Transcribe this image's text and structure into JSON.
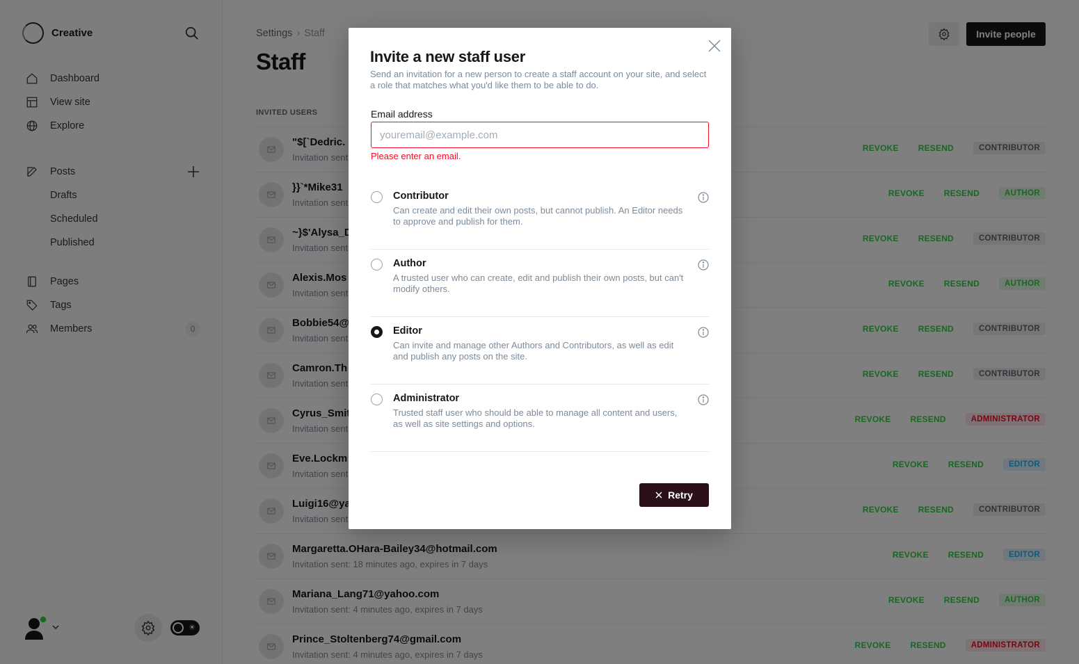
{
  "sidebar": {
    "brand": "Creative",
    "nav": [
      {
        "label": "Dashboard",
        "icon": "home-icon"
      },
      {
        "label": "View site",
        "icon": "layout-icon"
      },
      {
        "label": "Explore",
        "icon": "globe-icon"
      }
    ],
    "posts": {
      "label": "Posts",
      "icon": "edit-icon"
    },
    "post_sub": [
      "Drafts",
      "Scheduled",
      "Published"
    ],
    "nav2": [
      {
        "label": "Pages",
        "icon": "page-icon"
      },
      {
        "label": "Tags",
        "icon": "tag-icon"
      },
      {
        "label": "Members",
        "icon": "members-icon"
      }
    ],
    "members_count": "0"
  },
  "header": {
    "breadcrumb_root": "Settings",
    "breadcrumb_current": "Staff",
    "title": "Staff",
    "invite_button": "Invite people"
  },
  "section_label": "INVITED USERS",
  "actions": {
    "revoke": "REVOKE",
    "resend": "RESEND"
  },
  "users": [
    {
      "email": "\"$[`Dedric.",
      "sub": "Invitation sent",
      "role": "CONTRIBUTOR"
    },
    {
      "email": "}}`*Mike31",
      "sub": "Invitation sent",
      "role": "AUTHOR"
    },
    {
      "email": "~}$'Alysa_D",
      "sub": "Invitation sent",
      "role": "CONTRIBUTOR"
    },
    {
      "email": "Alexis.Mos",
      "sub": "Invitation sent",
      "role": "AUTHOR"
    },
    {
      "email": "Bobbie54@",
      "sub": "Invitation sent",
      "role": "CONTRIBUTOR"
    },
    {
      "email": "Camron.Th",
      "sub": "Invitation sent",
      "role": "CONTRIBUTOR"
    },
    {
      "email": "Cyrus_Smit",
      "sub": "Invitation sent",
      "role": "ADMINISTRATOR"
    },
    {
      "email": "Eve.Lockm",
      "sub": "Invitation sent",
      "role": "EDITOR"
    },
    {
      "email": "Luigi16@ya",
      "sub": "Invitation sent",
      "role": "CONTRIBUTOR"
    },
    {
      "email": "Margaretta.OHara-Bailey34@hotmail.com",
      "sub": "Invitation sent: 18 minutes ago, expires in 7 days",
      "role": "EDITOR"
    },
    {
      "email": "Mariana_Lang71@yahoo.com",
      "sub": "Invitation sent: 4 minutes ago, expires in 7 days",
      "role": "AUTHOR"
    },
    {
      "email": "Prince_Stoltenberg74@gmail.com",
      "sub": "Invitation sent: 4 minutes ago, expires in 7 days",
      "role": "ADMINISTRATOR"
    }
  ],
  "modal": {
    "title": "Invite a new staff user",
    "description": "Send an invitation for a new person to create a staff account on your site, and select a role that matches what you'd like them to be able to do.",
    "email_label": "Email address",
    "email_value": "",
    "email_placeholder": "youremail@example.com",
    "error": "Please enter an email.",
    "roles": [
      {
        "name": "Contributor",
        "desc": "Can create and edit their own posts, but cannot publish. An Editor needs to approve and publish for them.",
        "checked": false
      },
      {
        "name": "Author",
        "desc": "A trusted user who can create, edit and publish their own posts, but can't modify others.",
        "checked": false
      },
      {
        "name": "Editor",
        "desc": "Can invite and manage other Authors and Contributors, as well as edit and publish any posts on the site.",
        "checked": true
      },
      {
        "name": "Administrator",
        "desc": "Trusted staff user who should be able to manage all content and users, as well as site settings and options.",
        "checked": false
      }
    ],
    "retry_button": "Retry"
  },
  "colors": {
    "accent_green": "#30cf43",
    "error_red": "#f50b23",
    "retry_bg": "#2c1018",
    "dark": "#15171a"
  }
}
